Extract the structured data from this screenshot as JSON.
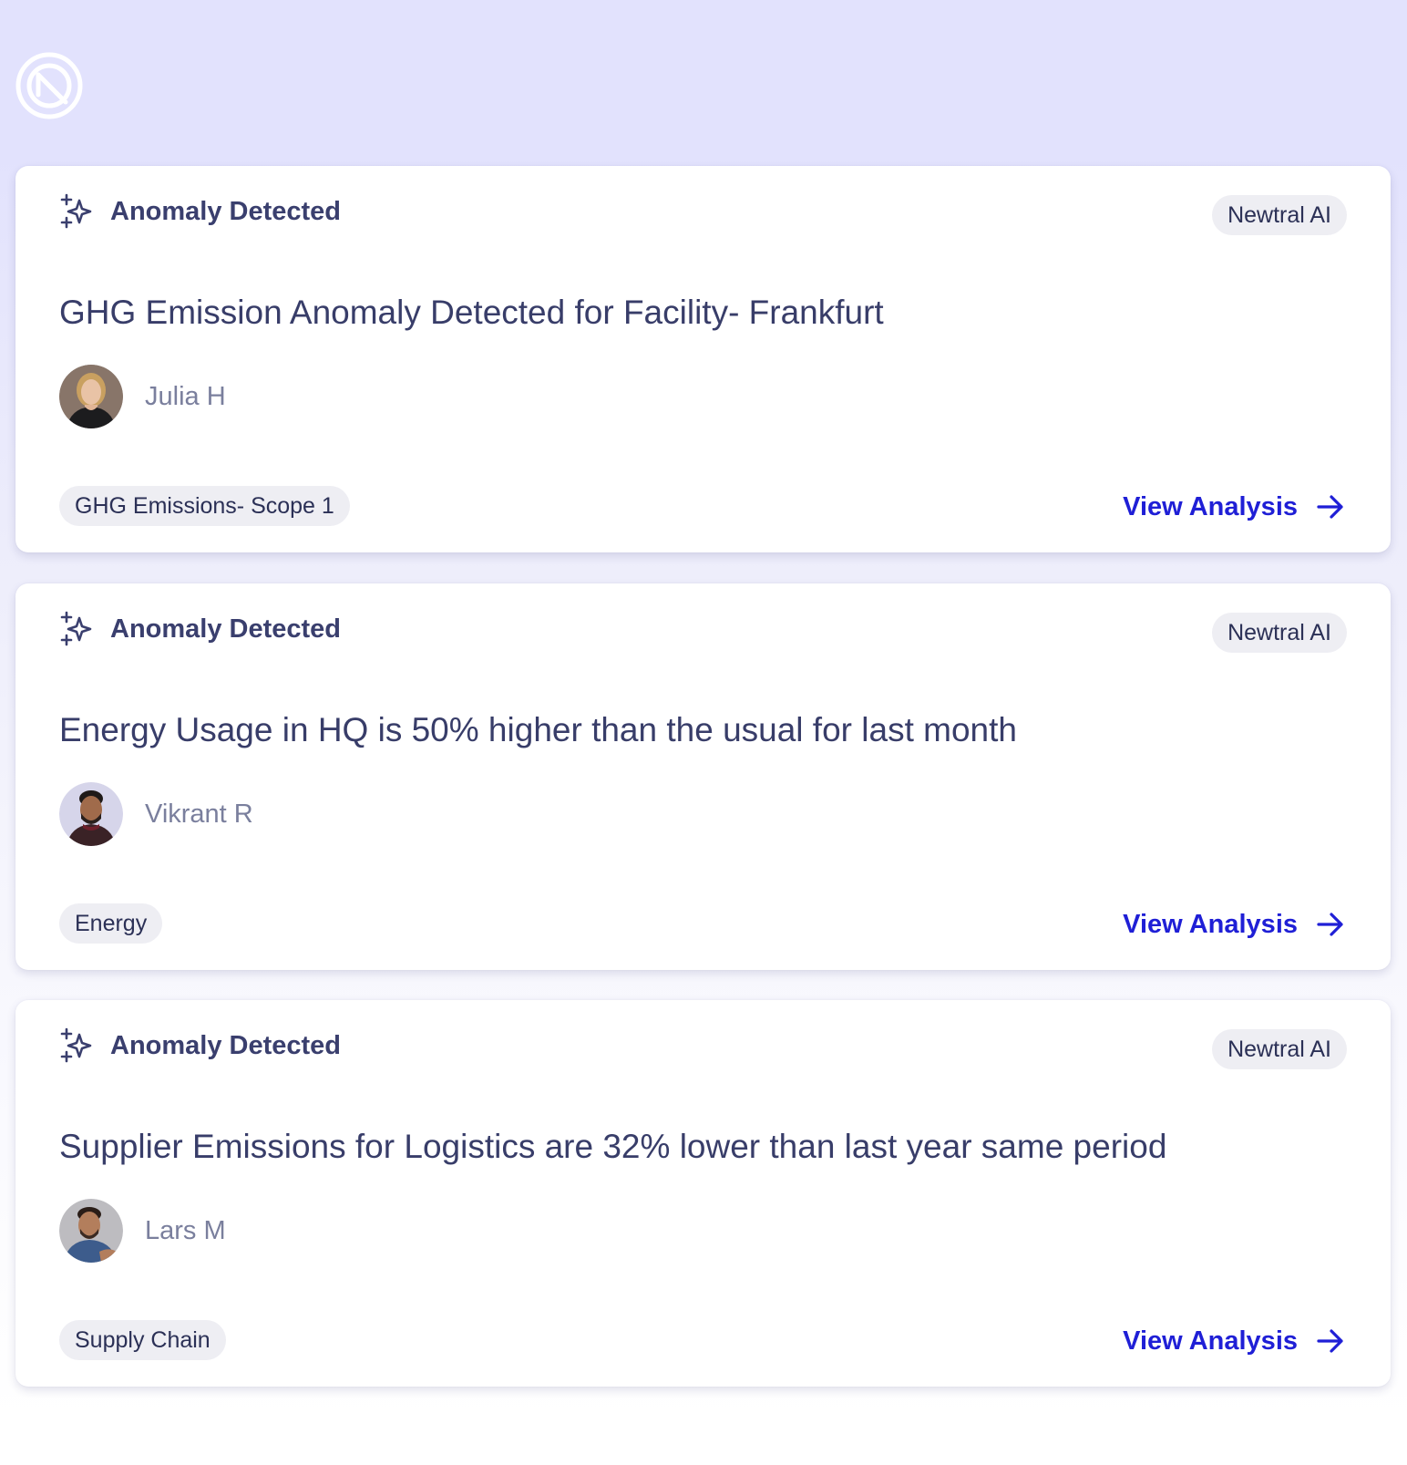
{
  "cards": [
    {
      "header": "Anomaly Detected",
      "badge": "Newtral AI",
      "title": "GHG Emission Anomaly Detected for Facility- Frankfurt",
      "author": "Julia H",
      "avatar_icon": "woman-portrait",
      "tag": "GHG Emissions- Scope 1",
      "action": "View Analysis"
    },
    {
      "header": "Anomaly Detected",
      "badge": "Newtral AI",
      "title": "Energy Usage in HQ is 50% higher than the usual for last month",
      "author": "Vikrant R",
      "avatar_icon": "man-portrait",
      "tag": "Energy",
      "action": "View Analysis"
    },
    {
      "header": "Anomaly Detected",
      "badge": "Newtral AI",
      "title": "Supplier Emissions for Logistics are 32% lower than last year same period",
      "author": "Lars M",
      "avatar_icon": "man-portrait",
      "tag": "Supply Chain",
      "action": "View Analysis"
    }
  ],
  "icons": {
    "logo": "newtral-logo",
    "header": "sparkles-icon",
    "action": "arrow-right-icon"
  },
  "colors": {
    "accent": "#1f1fd6",
    "heading": "#383d69",
    "muted": "#7a7f9d",
    "pill_bg": "#eeeef3",
    "page_bg": "#e2e2fd"
  }
}
